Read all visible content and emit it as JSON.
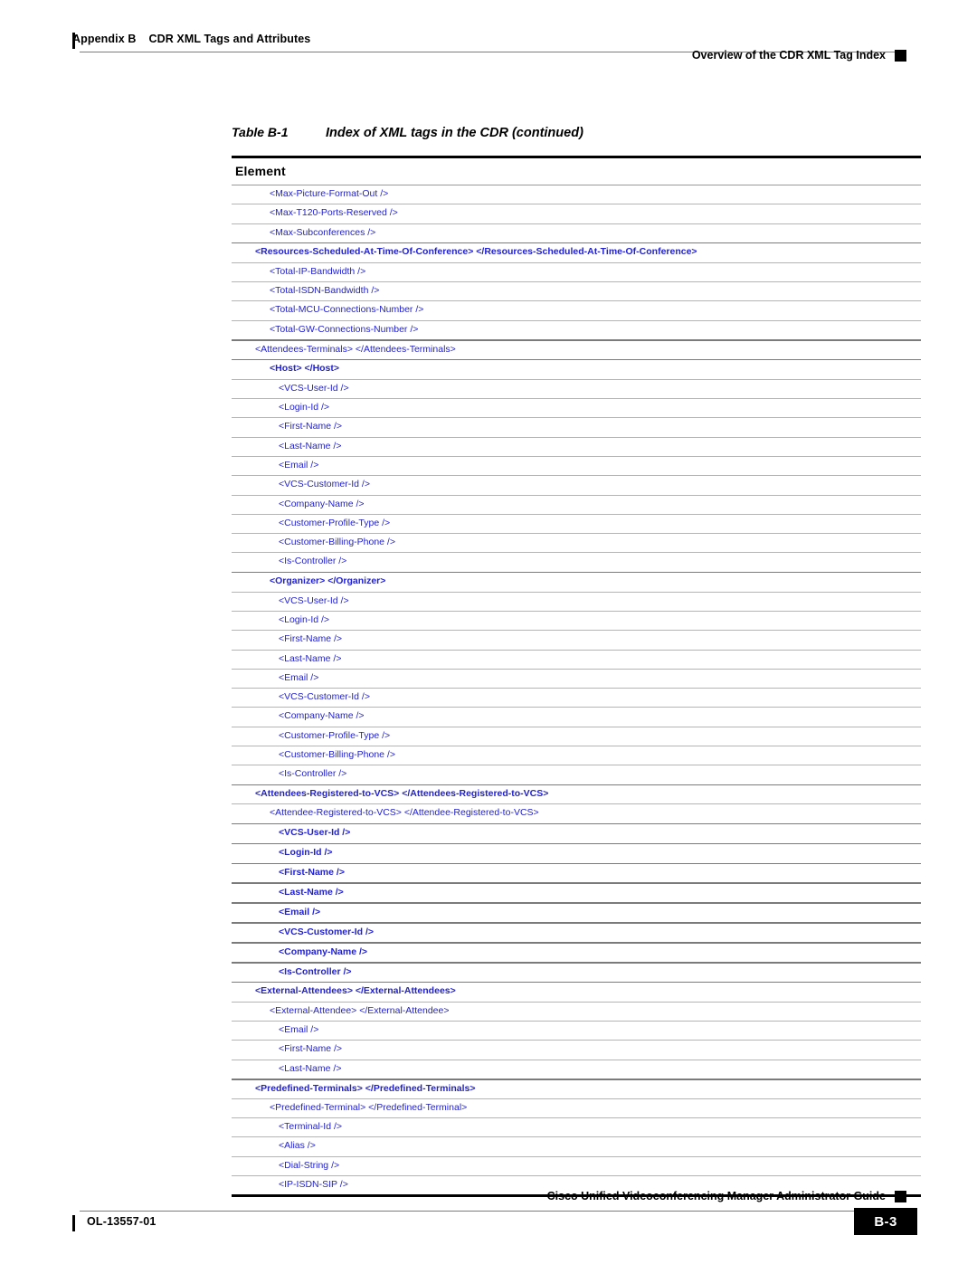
{
  "header": {
    "appendix": "Appendix B",
    "appendix_title": "CDR XML Tags and Attributes",
    "section": "Overview of the CDR XML Tag Index"
  },
  "caption": {
    "number": "Table B-1",
    "title": "Index of XML tags in the CDR (continued)"
  },
  "table": {
    "column_header": "Element",
    "rows": [
      {
        "text": "<Max-Picture-Format-Out />",
        "level": 1,
        "bold": false
      },
      {
        "text": "<Max-T120-Ports-Reserved />",
        "level": 1,
        "bold": false
      },
      {
        "text": "<Max-Subconferences />",
        "level": 1,
        "bold": false
      },
      {
        "text": "<Resources-Scheduled-At-Time-Of-Conference> </Resources-Scheduled-At-Time-Of-Conference>",
        "level": 0,
        "bold": true
      },
      {
        "text": "<Total-IP-Bandwidth />",
        "level": 1,
        "bold": false
      },
      {
        "text": "<Total-ISDN-Bandwidth />",
        "level": 1,
        "bold": false
      },
      {
        "text": "<Total-MCU-Connections-Number />",
        "level": 1,
        "bold": false
      },
      {
        "text": "<Total-GW-Connections-Number />",
        "level": 1,
        "bold": false
      },
      {
        "text": "<Attendees-Terminals> </Attendees-Terminals>",
        "level": 0,
        "bold": false
      },
      {
        "text": "<Host> </Host>",
        "level": 1,
        "bold": true
      },
      {
        "text": "<VCS-User-Id />",
        "level": 2,
        "bold": false
      },
      {
        "text": "<Login-Id />",
        "level": 2,
        "bold": false
      },
      {
        "text": "<First-Name />",
        "level": 2,
        "bold": false
      },
      {
        "text": "<Last-Name />",
        "level": 2,
        "bold": false
      },
      {
        "text": "<Email />",
        "level": 2,
        "bold": false
      },
      {
        "text": "<VCS-Customer-Id />",
        "level": 2,
        "bold": false
      },
      {
        "text": "<Company-Name />",
        "level": 2,
        "bold": false
      },
      {
        "text": "<Customer-Profile-Type />",
        "level": 2,
        "bold": false
      },
      {
        "text": "<Customer-Billing-Phone />",
        "level": 2,
        "bold": false
      },
      {
        "text": "<Is-Controller />",
        "level": 2,
        "bold": false
      },
      {
        "text": "<Organizer> </Organizer>",
        "level": 1,
        "bold": true
      },
      {
        "text": "<VCS-User-Id />",
        "level": 2,
        "bold": false
      },
      {
        "text": "<Login-Id />",
        "level": 2,
        "bold": false
      },
      {
        "text": "<First-Name />",
        "level": 2,
        "bold": false
      },
      {
        "text": "<Last-Name />",
        "level": 2,
        "bold": false
      },
      {
        "text": "<Email />",
        "level": 2,
        "bold": false
      },
      {
        "text": "<VCS-Customer-Id />",
        "level": 2,
        "bold": false
      },
      {
        "text": "<Company-Name />",
        "level": 2,
        "bold": false
      },
      {
        "text": "<Customer-Profile-Type />",
        "level": 2,
        "bold": false
      },
      {
        "text": "<Customer-Billing-Phone />",
        "level": 2,
        "bold": false
      },
      {
        "text": "<Is-Controller />",
        "level": 2,
        "bold": false
      },
      {
        "text": "<Attendees-Registered-to-VCS> </Attendees-Registered-to-VCS>",
        "level": 0,
        "bold": true
      },
      {
        "text": "<Attendee-Registered-to-VCS> </Attendee-Registered-to-VCS>",
        "level": 1,
        "bold": false
      },
      {
        "text": "<VCS-User-Id />",
        "level": 2,
        "bold": true
      },
      {
        "text": "<Login-Id />",
        "level": 2,
        "bold": true
      },
      {
        "text": "<First-Name />",
        "level": 2,
        "bold": true
      },
      {
        "text": "<Last-Name />",
        "level": 2,
        "bold": true
      },
      {
        "text": "<Email />",
        "level": 2,
        "bold": true
      },
      {
        "text": "<VCS-Customer-Id />",
        "level": 2,
        "bold": true
      },
      {
        "text": "<Company-Name />",
        "level": 2,
        "bold": true
      },
      {
        "text": "<Is-Controller />",
        "level": 2,
        "bold": true
      },
      {
        "text": "<External-Attendees> </External-Attendees>",
        "level": 0,
        "bold": true
      },
      {
        "text": "<External-Attendee> </External-Attendee>",
        "level": 1,
        "bold": false
      },
      {
        "text": "<Email />",
        "level": 2,
        "bold": false
      },
      {
        "text": "<First-Name />",
        "level": 2,
        "bold": false
      },
      {
        "text": "<Last-Name />",
        "level": 2,
        "bold": false
      },
      {
        "text": "<Predefined-Terminals> </Predefined-Terminals>",
        "level": 0,
        "bold": true
      },
      {
        "text": "<Predefined-Terminal> </Predefined-Terminal>",
        "level": 1,
        "bold": false
      },
      {
        "text": "<Terminal-Id />",
        "level": 2,
        "bold": false
      },
      {
        "text": "<Alias />",
        "level": 2,
        "bold": false
      },
      {
        "text": "<Dial-String />",
        "level": 2,
        "bold": false
      },
      {
        "text": "<IP-ISDN-SIP />",
        "level": 2,
        "bold": false
      }
    ]
  },
  "footer": {
    "guide_title": "Cisco Unified Videoconferencing Manager Administrator Guide",
    "doc_id": "OL-13557-01",
    "page_number": "B-3"
  },
  "colors": {
    "tag_blue": "#2222cc",
    "rule_gray": "#b4b4b4",
    "rule_dark": "#000000"
  }
}
